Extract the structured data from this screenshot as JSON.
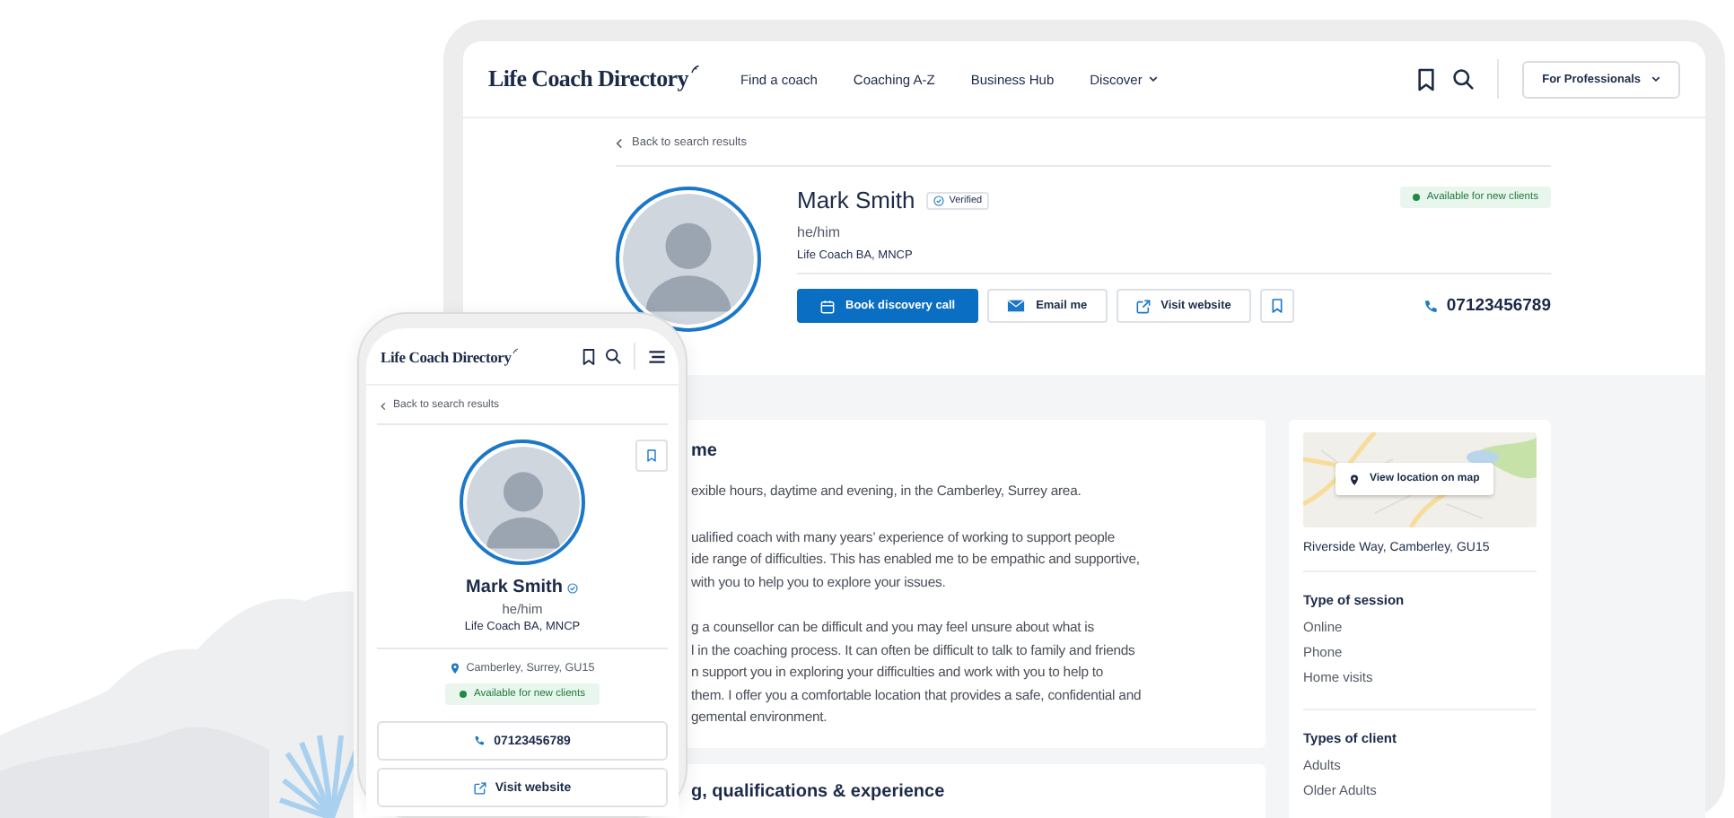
{
  "tablet": {
    "header": {
      "logo": "Life Coach Directory",
      "nav": [
        {
          "label": "Find a coach",
          "has_menu": false
        },
        {
          "label": "Coaching A-Z",
          "has_menu": false
        },
        {
          "label": "Business Hub",
          "has_menu": false
        },
        {
          "label": "Discover",
          "has_menu": true
        }
      ],
      "professionals_button": "For Professionals"
    },
    "back_link": "Back to search results",
    "profile": {
      "name": "Mark Smith",
      "verified": "Verified",
      "pronouns": "he/him",
      "credentials": "Life Coach BA, MNCP",
      "availability": "Available for new clients",
      "actions": [
        {
          "kind": "primary",
          "label": "Book discovery call"
        },
        {
          "kind": "email",
          "label": "Email me"
        },
        {
          "kind": "website",
          "label": "Visit website"
        },
        {
          "kind": "bookmark"
        }
      ],
      "phone": "07123456789"
    },
    "about": {
      "heading": "me",
      "paragraphs": [
        [
          "exible hours, daytime and evening, in the Camberley, Surrey area."
        ],
        [
          "ualified coach with many years’ experience of working to support people",
          "ide range of difficulties. This has enabled me to be empathic and supportive,",
          "with you to help you to explore your issues."
        ],
        [
          "g a counsellor can be difficult and you may feel unsure about what is",
          "l in the coaching process. It can often be difficult to talk to family and friends",
          "n support you in exploring your difficulties and work with you to help to",
          "them. I offer you a comfortable location that provides a safe, confidential and",
          "gemental environment."
        ]
      ]
    },
    "training_heading": "g, qualifications & experience",
    "sidebar": {
      "map_button": "View location on map",
      "address": "Riverside Way, Camberley, GU15",
      "sections": [
        {
          "title": "Type of session",
          "items": [
            "Online",
            "Phone",
            "Home visits"
          ]
        },
        {
          "title": "Types of client",
          "items": [
            "Adults",
            "Older Adults"
          ]
        }
      ]
    }
  },
  "phone": {
    "logo": "Life Coach Directory",
    "back_link": "Back to search results",
    "name": "Mark Smith",
    "pronouns": "he/him",
    "credentials": "Life Coach BA, MNCP",
    "location": "Camberley, Surrey, GU15",
    "availability": "Available for new clients",
    "buttons": [
      {
        "kind": "phone",
        "label": "07123456789"
      },
      {
        "kind": "website",
        "label": "Visit website"
      }
    ]
  }
}
